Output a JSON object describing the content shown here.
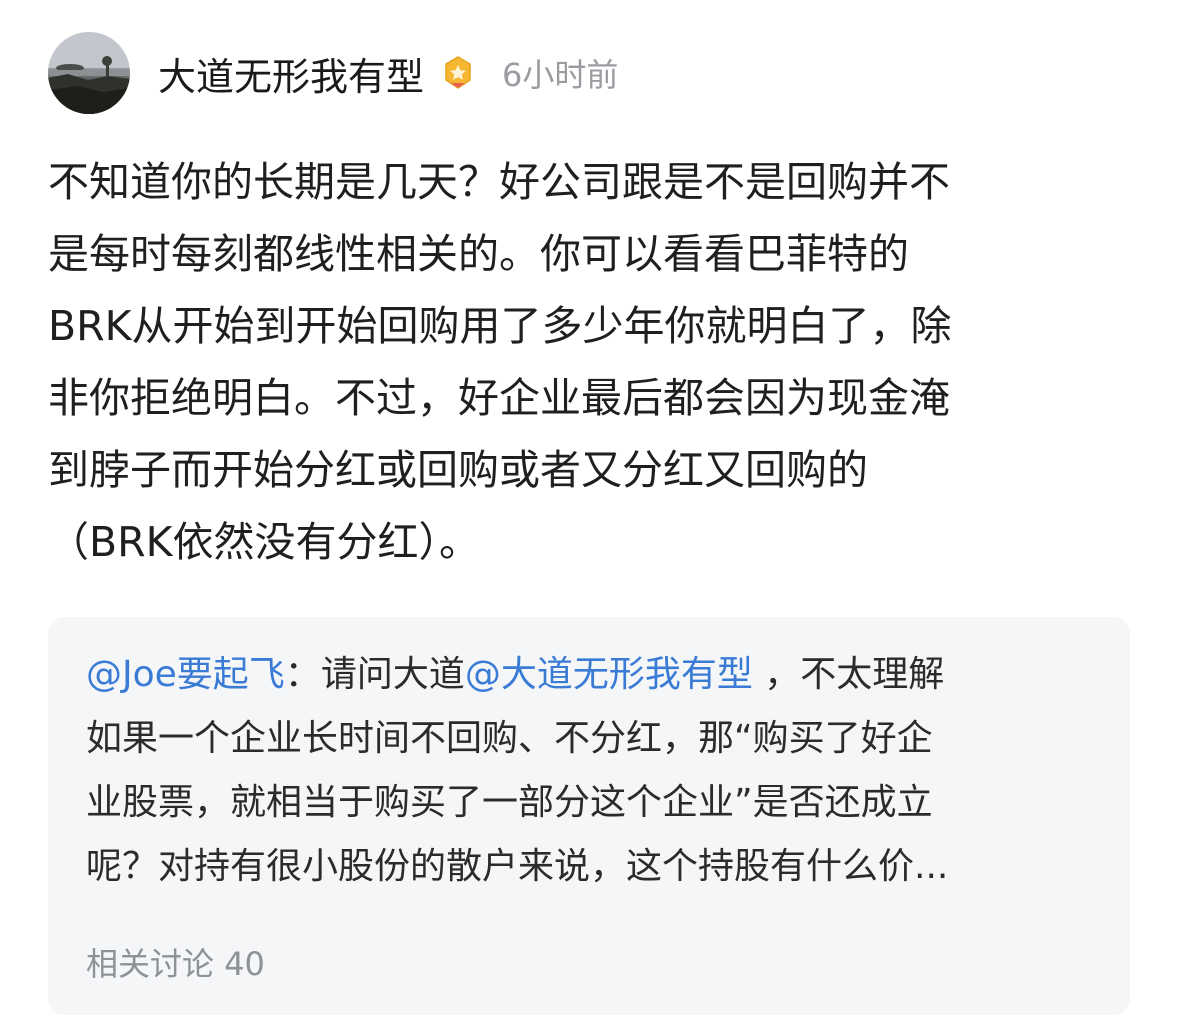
{
  "header": {
    "username": "大道无形我有型",
    "timestamp": "6小时前",
    "badge_icon": "gold-medal-icon",
    "avatar_icon": "landscape-avatar"
  },
  "post": {
    "lines": [
      "不知道你的长期是几天？好公司跟是不是回购并不",
      "是每时每刻都线性相关的。你可以看看巴菲特的",
      "BRK从开始到开始回购用了多少年你就明白了，除",
      "非你拒绝明白。不过，好企业最后都会因为现金淹",
      "到脖子而开始分红或回购或者又分红又回购的",
      "（BRK依然没有分红）。"
    ]
  },
  "quote": {
    "author_mention": "@Joe要起飞",
    "colon": "：",
    "line1_prefix": "请问大道",
    "inline_mention": "@大道无形我有型",
    "line1_suffix": " ，不太理解",
    "lines": [
      "如果一个企业长时间不回购、不分红，那“购买了好企",
      "业股票，就相当于购买了一部分这个企业”是否还成立",
      "呢？对持有很小股份的散户来说，这个持股有什么价..."
    ],
    "related_label": "相关讨论 40"
  },
  "colors": {
    "mention": "#3a7bd5",
    "timestamp": "#9a9ca1",
    "card_background": "#f5f6f8",
    "badge_gold": "#f5b731"
  }
}
